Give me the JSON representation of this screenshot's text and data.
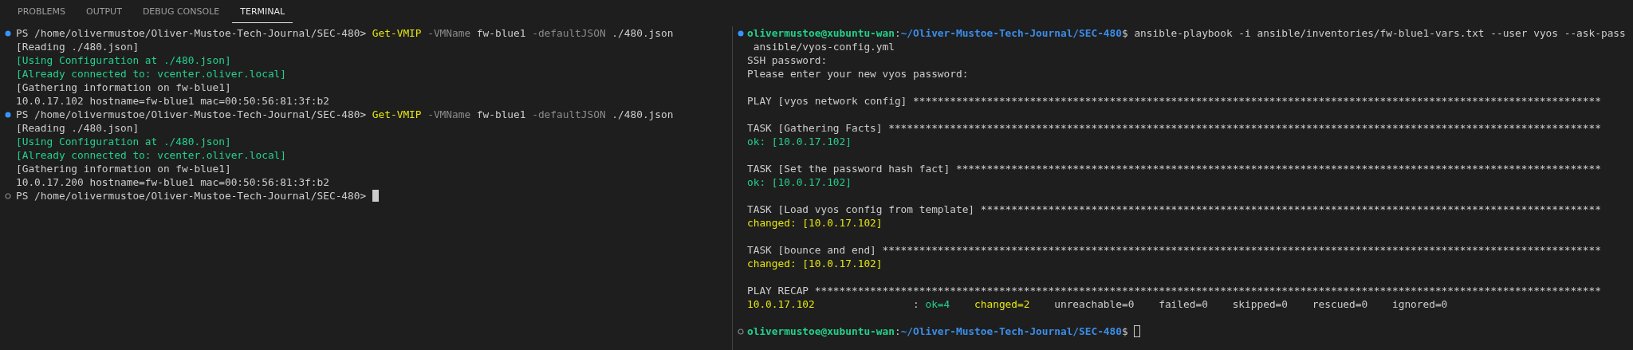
{
  "panel_tabs": [
    {
      "label": "PROBLEMS",
      "selected": false
    },
    {
      "label": "OUTPUT",
      "selected": false
    },
    {
      "label": "DEBUG CONSOLE",
      "selected": false
    },
    {
      "label": "TERMINAL",
      "selected": true
    }
  ],
  "terminals": [
    {
      "focused": true,
      "lines": [
        {
          "kind": "command",
          "segments": [
            {
              "text": "PS /home/olivermustoe/Oliver-Mustoe-Tech-Journal/SEC-480> ",
              "color": "#cccccc"
            },
            {
              "text": "Get-VMIP",
              "color": "#e5e510"
            },
            {
              "text": " -VMName",
              "color": "#8a8a8a"
            },
            {
              "text": " fw-blue1",
              "color": "#cccccc"
            },
            {
              "text": " -defaultJSON",
              "color": "#8a8a8a"
            },
            {
              "text": " ./480.json",
              "color": "#cccccc"
            }
          ]
        },
        {
          "kind": "output",
          "segments": [
            {
              "text": "[Reading ./480.json]",
              "color": "#cccccc"
            }
          ]
        },
        {
          "kind": "output",
          "segments": [
            {
              "text": "[Using Configuration at ./480.json]",
              "color": "#23d18b"
            }
          ]
        },
        {
          "kind": "output",
          "segments": [
            {
              "text": "[Already connected to: vcenter.oliver.local]",
              "color": "#23d18b"
            }
          ]
        },
        {
          "kind": "output",
          "segments": [
            {
              "text": "[Gathering information on fw-blue1]",
              "color": "#cccccc"
            }
          ]
        },
        {
          "kind": "output",
          "segments": [
            {
              "text": "10.0.17.102 hostname=fw-blue1 mac=00:50:56:81:3f:b2",
              "color": "#cccccc"
            }
          ]
        },
        {
          "kind": "command",
          "segments": [
            {
              "text": "PS /home/olivermustoe/Oliver-Mustoe-Tech-Journal/SEC-480> ",
              "color": "#cccccc"
            },
            {
              "text": "Get-VMIP",
              "color": "#e5e510"
            },
            {
              "text": " -VMName",
              "color": "#8a8a8a"
            },
            {
              "text": " fw-blue1",
              "color": "#cccccc"
            },
            {
              "text": " -defaultJSON",
              "color": "#8a8a8a"
            },
            {
              "text": " ./480.json",
              "color": "#cccccc"
            }
          ]
        },
        {
          "kind": "output",
          "segments": [
            {
              "text": "[Reading ./480.json]",
              "color": "#cccccc"
            }
          ]
        },
        {
          "kind": "output",
          "segments": [
            {
              "text": "[Using Configuration at ./480.json]",
              "color": "#23d18b"
            }
          ]
        },
        {
          "kind": "output",
          "segments": [
            {
              "text": "[Already connected to: vcenter.oliver.local]",
              "color": "#23d18b"
            }
          ]
        },
        {
          "kind": "output",
          "segments": [
            {
              "text": "[Gathering information on fw-blue1]",
              "color": "#cccccc"
            }
          ]
        },
        {
          "kind": "output",
          "segments": [
            {
              "text": "10.0.17.200 hostname=fw-blue1 mac=00:50:56:81:3f:b2",
              "color": "#cccccc"
            }
          ]
        },
        {
          "kind": "prompt",
          "segments": [
            {
              "text": "PS /home/olivermustoe/Oliver-Mustoe-Tech-Journal/SEC-480> ",
              "color": "#cccccc"
            }
          ]
        }
      ]
    },
    {
      "focused": false,
      "lines": [
        {
          "kind": "command",
          "segments": [
            {
              "text": "olivermustoe@xubuntu-wan",
              "color": "#23d18b",
              "kind": "bold"
            },
            {
              "text": ":"
            },
            {
              "text": "~/Oliver-Mustoe-Tech-Journal/SEC-480",
              "color": "#3b8eea",
              "kind": "bold"
            },
            {
              "text": "$ ansible-playbook -i ansible/inventories/fw-blue1-vars.txt --user vyos --ask-pass",
              "color": "#cccccc"
            }
          ]
        },
        {
          "kind": "output",
          "segments": [
            {
              "text": " ansible/vyos-config.yml",
              "color": "#cccccc"
            }
          ]
        },
        {
          "kind": "output",
          "segments": [
            {
              "text": "SSH password:",
              "color": "#cccccc"
            }
          ]
        },
        {
          "kind": "output",
          "segments": [
            {
              "text": "Please enter your new vyos password:",
              "color": "#cccccc"
            }
          ]
        },
        {
          "kind": "blank"
        },
        {
          "kind": "output",
          "segments": [
            {
              "text": "PLAY [vyos network config] ****************************************************************************************************************",
              "color": "#cccccc"
            }
          ]
        },
        {
          "kind": "blank"
        },
        {
          "kind": "output",
          "segments": [
            {
              "text": "TASK [Gathering Facts] ********************************************************************************************************************",
              "color": "#cccccc"
            }
          ]
        },
        {
          "kind": "output",
          "segments": [
            {
              "text": "ok: [10.0.17.102]",
              "color": "#23d18b"
            }
          ]
        },
        {
          "kind": "blank"
        },
        {
          "kind": "output",
          "segments": [
            {
              "text": "TASK [Set the password hash fact] *********************************************************************************************************",
              "color": "#cccccc"
            }
          ]
        },
        {
          "kind": "output",
          "segments": [
            {
              "text": "ok: [10.0.17.102]",
              "color": "#23d18b"
            }
          ]
        },
        {
          "kind": "blank"
        },
        {
          "kind": "output",
          "segments": [
            {
              "text": "TASK [Load vyos config from template] *****************************************************************************************************",
              "color": "#cccccc"
            }
          ]
        },
        {
          "kind": "output",
          "segments": [
            {
              "text": "changed: [10.0.17.102]",
              "color": "#e5e510"
            }
          ]
        },
        {
          "kind": "blank"
        },
        {
          "kind": "output",
          "segments": [
            {
              "text": "TASK [bounce and end] *********************************************************************************************************************",
              "color": "#cccccc"
            }
          ]
        },
        {
          "kind": "output",
          "segments": [
            {
              "text": "changed: [10.0.17.102]",
              "color": "#e5e510"
            }
          ]
        },
        {
          "kind": "blank"
        },
        {
          "kind": "output",
          "segments": [
            {
              "text": "PLAY RECAP ********************************************************************************************************************************",
              "color": "#cccccc"
            }
          ]
        },
        {
          "kind": "output",
          "segments": [
            {
              "text": "10.0.17.102",
              "color": "#e5e510"
            },
            {
              "text": "                : "
            },
            {
              "text": "ok=4    ",
              "color": "#23d18b"
            },
            {
              "text": "changed=2",
              "color": "#e5e510"
            },
            {
              "text": "    unreachable=0    failed=0    skipped=0    rescued=0    ignored=0",
              "color": "#cccccc"
            }
          ]
        },
        {
          "kind": "blank"
        },
        {
          "kind": "prompt",
          "segments": [
            {
              "text": "olivermustoe@xubuntu-wan",
              "color": "#23d18b",
              "kind": "bold"
            },
            {
              "text": ":"
            },
            {
              "text": "~/Oliver-Mustoe-Tech-Journal/SEC-480",
              "color": "#3b8eea",
              "kind": "bold"
            },
            {
              "text": "$ ",
              "color": "#cccccc"
            }
          ]
        }
      ]
    }
  ]
}
